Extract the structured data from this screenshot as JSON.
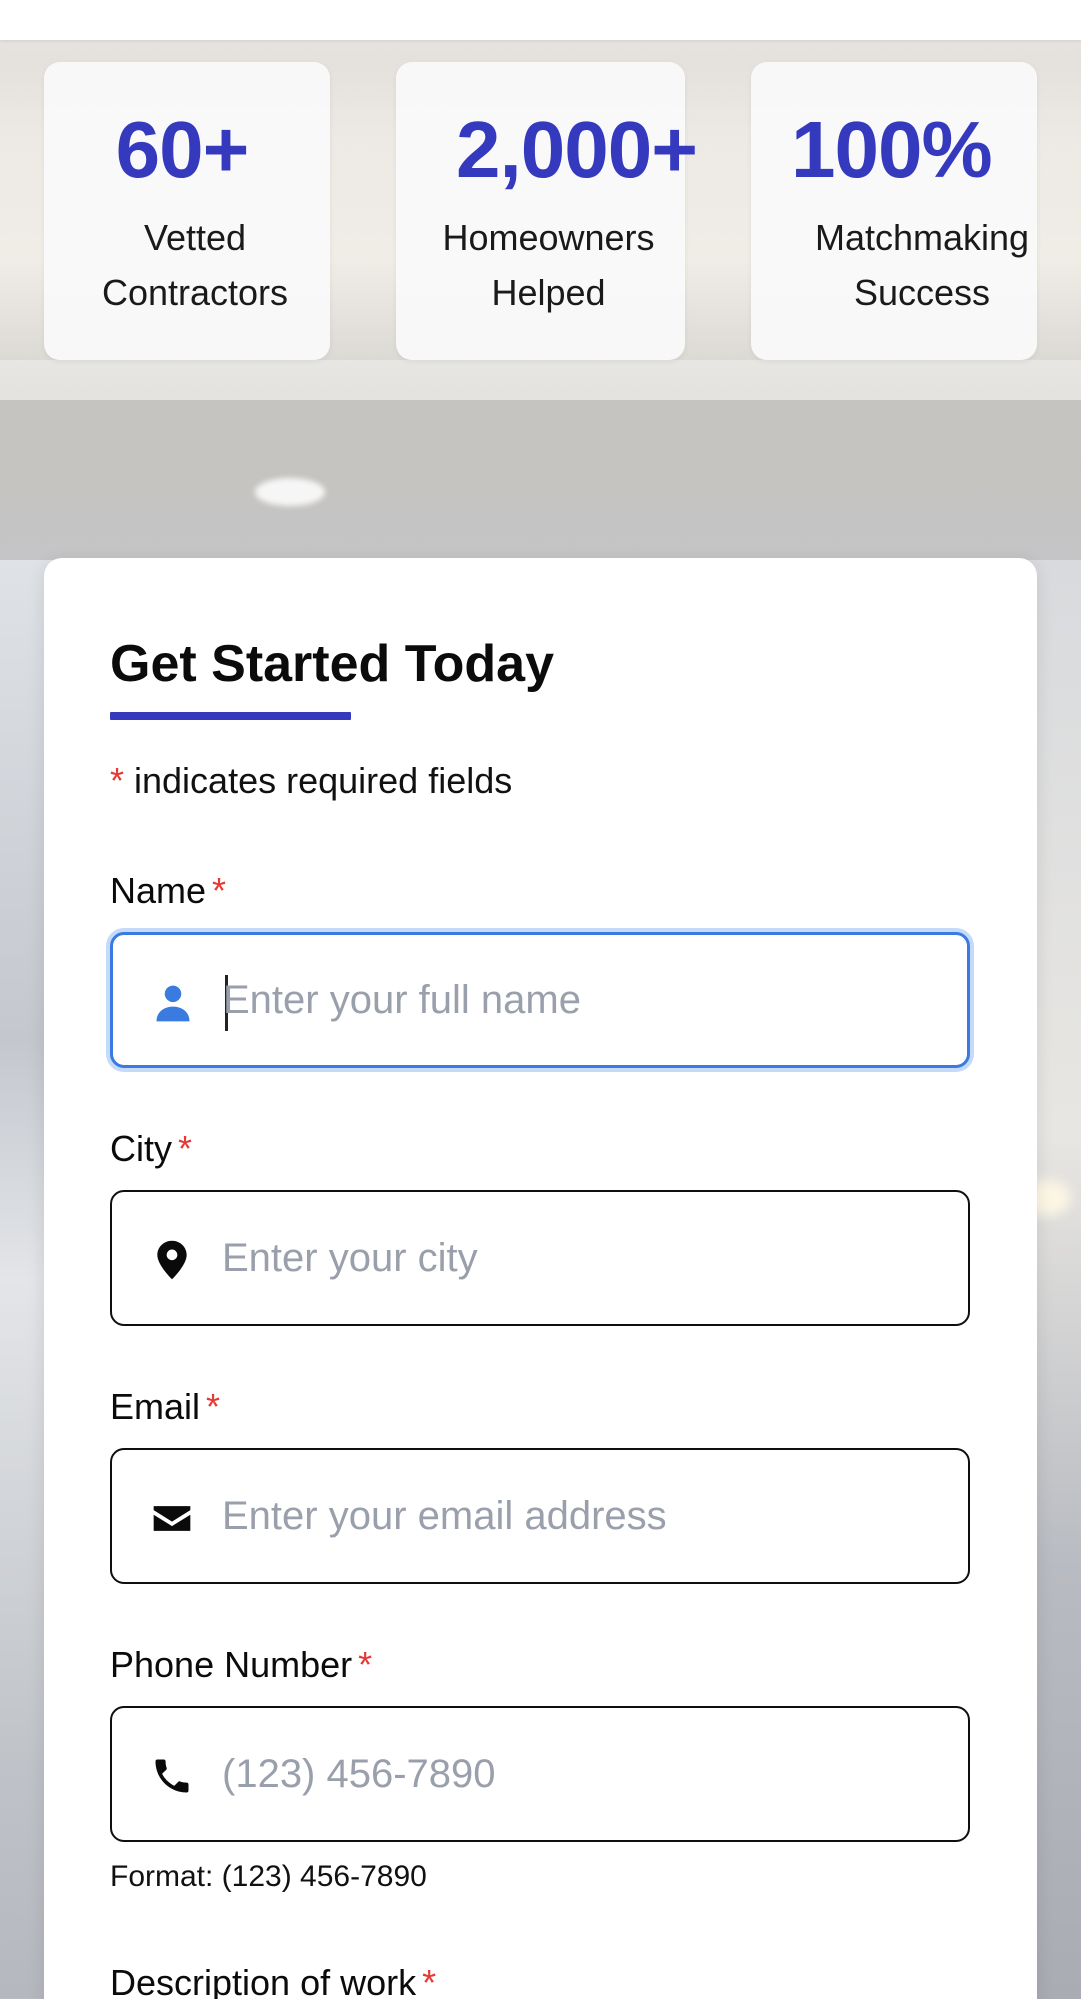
{
  "stats": [
    {
      "value": "60+",
      "label_line1": "Vetted",
      "label_line2": "Contractors"
    },
    {
      "value": "2,000+",
      "label_line1": "Homeowners",
      "label_line2": "Helped"
    },
    {
      "value": "100%",
      "label_line1": "Matchmaking",
      "label_line2": "Success"
    }
  ],
  "form": {
    "title": "Get Started Today",
    "required_note_marker": "*",
    "required_note_text": " indicates required fields",
    "fields": {
      "name": {
        "label": "Name",
        "required_marker": "*",
        "placeholder": "Enter your full name",
        "icon": "person-icon",
        "icon_color": "#3a7be0"
      },
      "city": {
        "label": "City",
        "required_marker": "*",
        "placeholder": "Enter your city",
        "icon": "location-pin-icon"
      },
      "email": {
        "label": "Email",
        "required_marker": "*",
        "placeholder": "Enter your email address",
        "icon": "envelope-icon"
      },
      "phone": {
        "label": "Phone Number",
        "required_marker": "*",
        "placeholder": "(123) 456-7890",
        "icon": "phone-icon",
        "helper": "Format: (123) 456-7890"
      },
      "description": {
        "label": "Description of work",
        "required_marker": "*"
      }
    }
  },
  "colors": {
    "accent": "#3539be",
    "focus": "#3a7be0",
    "required": "#e53935",
    "placeholder": "#9aa0ab"
  }
}
